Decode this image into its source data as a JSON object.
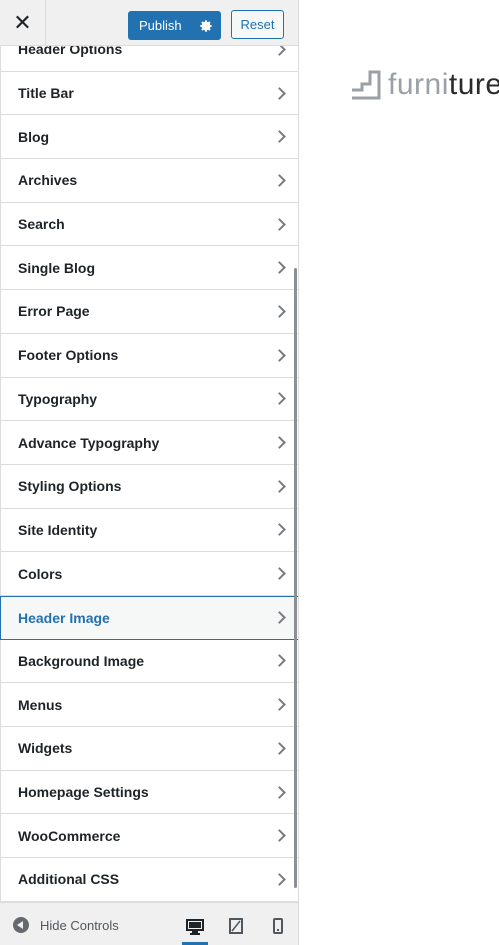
{
  "toolbar": {
    "publish_label": "Publish",
    "reset_label": "Reset"
  },
  "menu": [
    {
      "label": "Header Options"
    },
    {
      "label": "Title Bar"
    },
    {
      "label": "Blog"
    },
    {
      "label": "Archives"
    },
    {
      "label": "Search"
    },
    {
      "label": "Single Blog"
    },
    {
      "label": "Error Page"
    },
    {
      "label": "Footer Options"
    },
    {
      "label": "Typography"
    },
    {
      "label": "Advance Typography"
    },
    {
      "label": "Styling Options"
    },
    {
      "label": "Site Identity"
    },
    {
      "label": "Colors"
    },
    {
      "label": "Header Image",
      "active": true
    },
    {
      "label": "Background Image"
    },
    {
      "label": "Menus"
    },
    {
      "label": "Widgets"
    },
    {
      "label": "Homepage Settings"
    },
    {
      "label": "WooCommerce"
    },
    {
      "label": "Additional CSS"
    }
  ],
  "footer": {
    "hide_controls_label": "Hide Controls",
    "devices": [
      "desktop-icon",
      "tablet-icon",
      "mobile-icon"
    ],
    "active_device": "desktop"
  },
  "preview": {
    "logo_part1": "furni",
    "logo_part2": "ture"
  },
  "colors": {
    "accent": "#2271b1",
    "panel_bg": "#f0f0f1",
    "border": "#dcdcde"
  }
}
